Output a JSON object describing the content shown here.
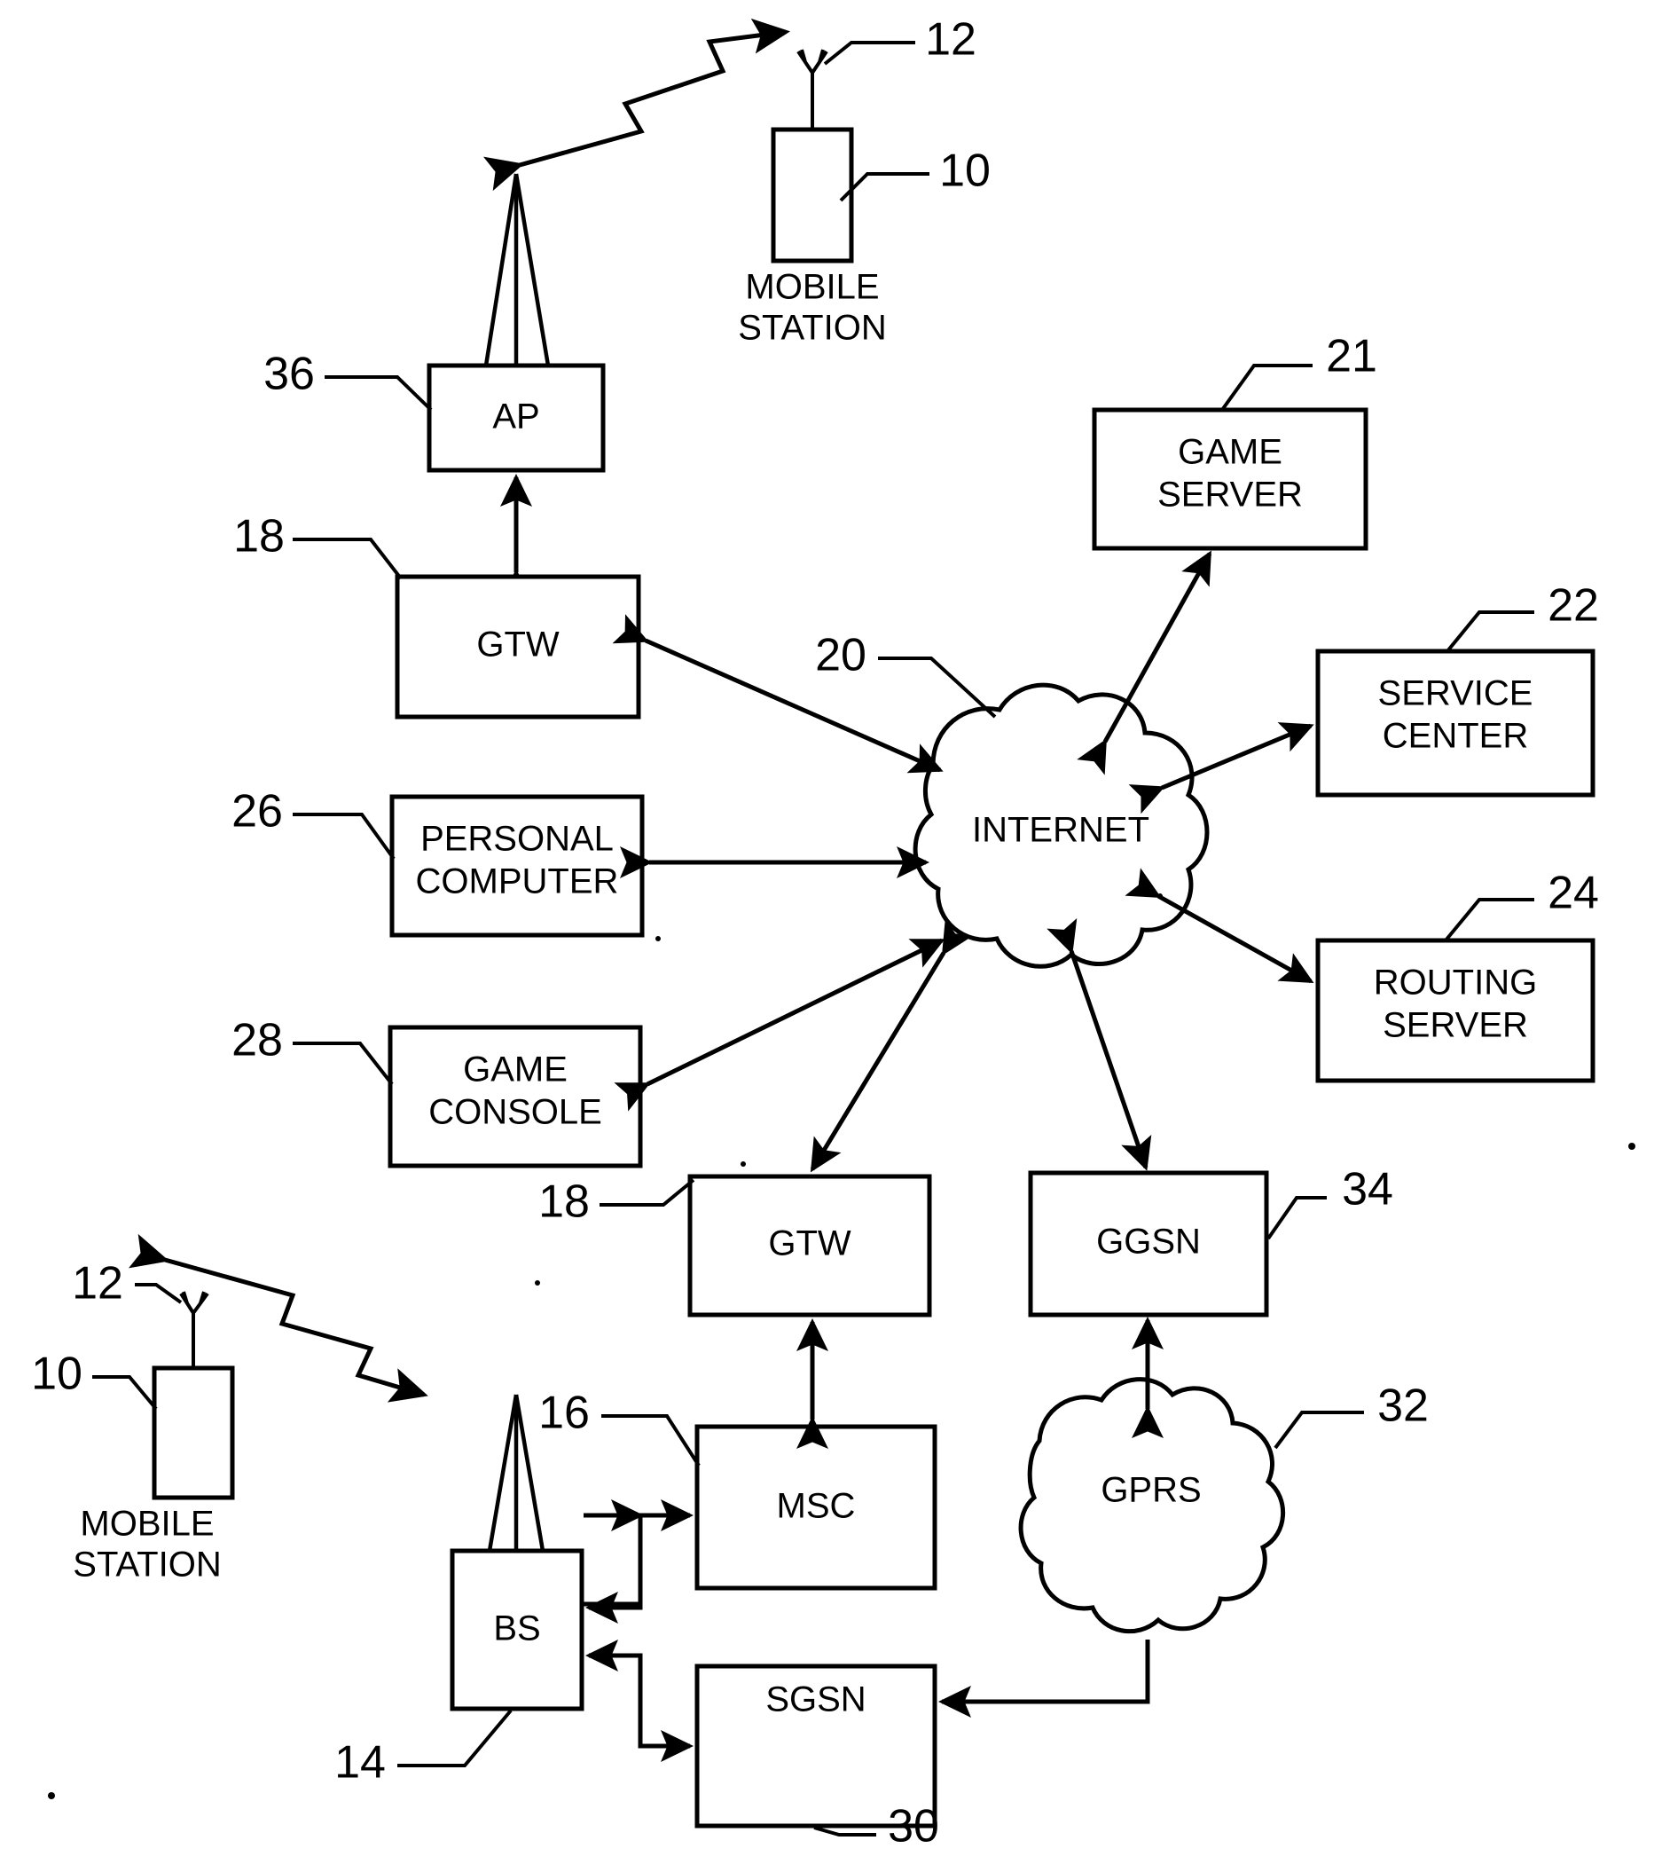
{
  "figure": {
    "type": "patent-network-diagram",
    "background": "#ffffff",
    "ink": "#000000"
  },
  "nodes": {
    "mobile_station_top": {
      "label_line1": "MOBILE",
      "label_line2": "STATION",
      "ref_device": "10",
      "ref_antenna": "12"
    },
    "access_point": {
      "label": "AP",
      "ref": "36"
    },
    "gateway_top": {
      "label": "GTW",
      "ref": "18"
    },
    "game_server": {
      "label_line1": "GAME",
      "label_line2": "SERVER",
      "ref": "21"
    },
    "service_center": {
      "label_line1": "SERVICE",
      "label_line2": "CENTER",
      "ref": "22"
    },
    "routing_server": {
      "label_line1": "ROUTING",
      "label_line2": "SERVER",
      "ref": "24"
    },
    "personal_computer": {
      "label_line1": "PERSONAL",
      "label_line2": "COMPUTER",
      "ref": "26"
    },
    "game_console": {
      "label_line1": "GAME",
      "label_line2": "CONSOLE",
      "ref": "28"
    },
    "internet": {
      "label": "INTERNET",
      "ref": "20"
    },
    "gateway_bottom": {
      "label": "GTW",
      "ref": "18"
    },
    "ggsn": {
      "label": "GGSN",
      "ref": "34"
    },
    "gprs": {
      "label": "GPRS",
      "ref": "32"
    },
    "mobile_station_bottom": {
      "label_line1": "MOBILE",
      "label_line2": "STATION",
      "ref_device": "10",
      "ref_antenna": "12"
    },
    "base_station": {
      "label": "BS",
      "ref": "14"
    },
    "msc": {
      "label": "MSC",
      "ref": "16"
    },
    "sgsn": {
      "label": "SGSN",
      "ref": "30"
    }
  },
  "links": [
    {
      "from": "mobile_station_top",
      "to": "access_point",
      "style": "radio-zigzag",
      "arrows": "both"
    },
    {
      "from": "access_point",
      "to": "gateway_top",
      "style": "line",
      "arrows": "both"
    },
    {
      "from": "gateway_top",
      "to": "internet",
      "style": "line",
      "arrows": "both"
    },
    {
      "from": "internet",
      "to": "game_server",
      "style": "line",
      "arrows": "both"
    },
    {
      "from": "internet",
      "to": "service_center",
      "style": "line",
      "arrows": "both"
    },
    {
      "from": "internet",
      "to": "routing_server",
      "style": "line",
      "arrows": "both"
    },
    {
      "from": "personal_computer",
      "to": "internet",
      "style": "line",
      "arrows": "both"
    },
    {
      "from": "game_console",
      "to": "internet",
      "style": "line",
      "arrows": "both"
    },
    {
      "from": "internet",
      "to": "gateway_bottom",
      "style": "line",
      "arrows": "both"
    },
    {
      "from": "internet",
      "to": "ggsn",
      "style": "line",
      "arrows": "both"
    },
    {
      "from": "gateway_bottom",
      "to": "msc",
      "style": "line",
      "arrows": "both"
    },
    {
      "from": "ggsn",
      "to": "gprs",
      "style": "line",
      "arrows": "both"
    },
    {
      "from": "mobile_station_bottom",
      "to": "base_station",
      "style": "radio-zigzag",
      "arrows": "both"
    },
    {
      "from": "msc",
      "to": "base_station",
      "style": "orthogonal",
      "arrows": "single"
    },
    {
      "from": "base_station",
      "to": "msc",
      "style": "orthogonal",
      "arrows": "single"
    },
    {
      "from": "base_station",
      "to": "sgsn",
      "style": "orthogonal",
      "arrows": "single"
    },
    {
      "from": "sgsn",
      "to": "base_station",
      "style": "orthogonal",
      "arrows": "single"
    },
    {
      "from": "gprs",
      "to": "sgsn",
      "style": "orthogonal",
      "arrows": "single"
    }
  ]
}
